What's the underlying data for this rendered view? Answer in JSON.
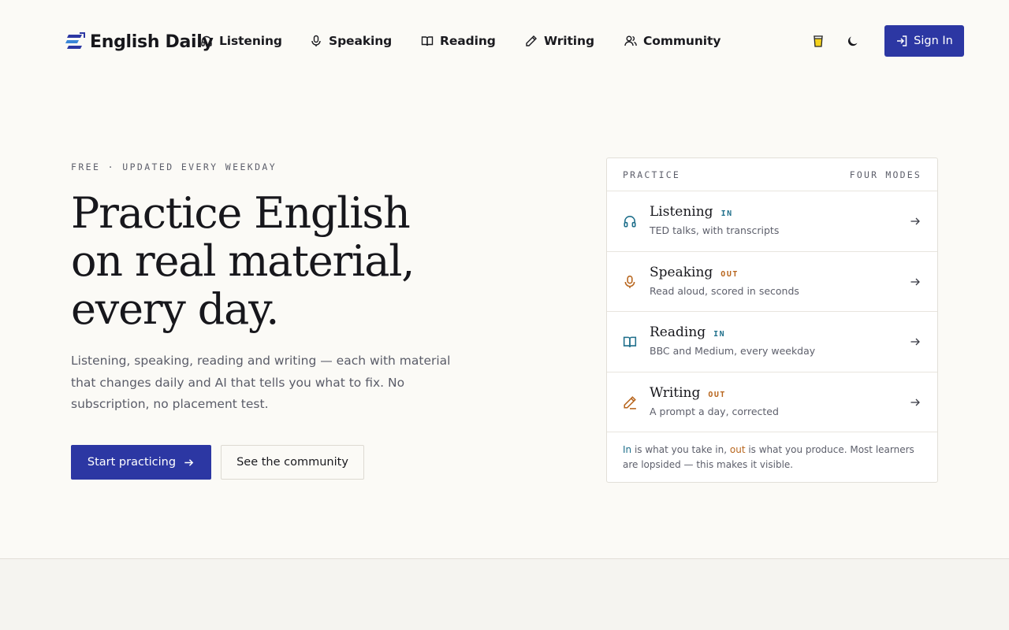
{
  "brand": {
    "name": "English Daily"
  },
  "nav": {
    "items": [
      {
        "label": "Listening",
        "icon": "headphones-icon"
      },
      {
        "label": "Speaking",
        "icon": "microphone-icon"
      },
      {
        "label": "Reading",
        "icon": "book-icon"
      },
      {
        "label": "Writing",
        "icon": "pencil-icon"
      },
      {
        "label": "Community",
        "icon": "users-icon"
      }
    ],
    "tip_icon": "beer-icon",
    "theme_icon": "moon-icon",
    "signin_label": "Sign In"
  },
  "hero": {
    "eyebrow": "FREE · UPDATED EVERY WEEKDAY",
    "headline_lines": [
      "Practice English",
      "on real material,",
      "every day."
    ],
    "subcopy": "Listening, speaking, reading and writing — each with material that changes daily and AI that tells you what to fix. No subscription, no placement test.",
    "primary_cta": "Start practicing",
    "secondary_cta": "See the community"
  },
  "practice": {
    "header_left": "PRACTICE",
    "header_right": "FOUR MODES",
    "modes": [
      {
        "title": "Listening",
        "tag": "IN",
        "desc": "TED talks, with transcripts",
        "icon": "headphones-icon"
      },
      {
        "title": "Speaking",
        "tag": "OUT",
        "desc": "Read aloud, scored in seconds",
        "icon": "microphone-icon"
      },
      {
        "title": "Reading",
        "tag": "IN",
        "desc": "BBC and Medium, every weekday",
        "icon": "book-icon"
      },
      {
        "title": "Writing",
        "tag": "OUT",
        "desc": "A prompt a day, corrected",
        "icon": "pencil-icon"
      }
    ],
    "footnote": {
      "in_word": "In",
      "part1": " is what you take in, ",
      "out_word": "out",
      "part2": " is what you produce. Most learners are lopsided — this makes it visible."
    }
  },
  "colors": {
    "accent": "#2c37a3",
    "in_tag": "#1f6f8b",
    "out_tag": "#b8661e",
    "background": "#fbfaf6"
  }
}
